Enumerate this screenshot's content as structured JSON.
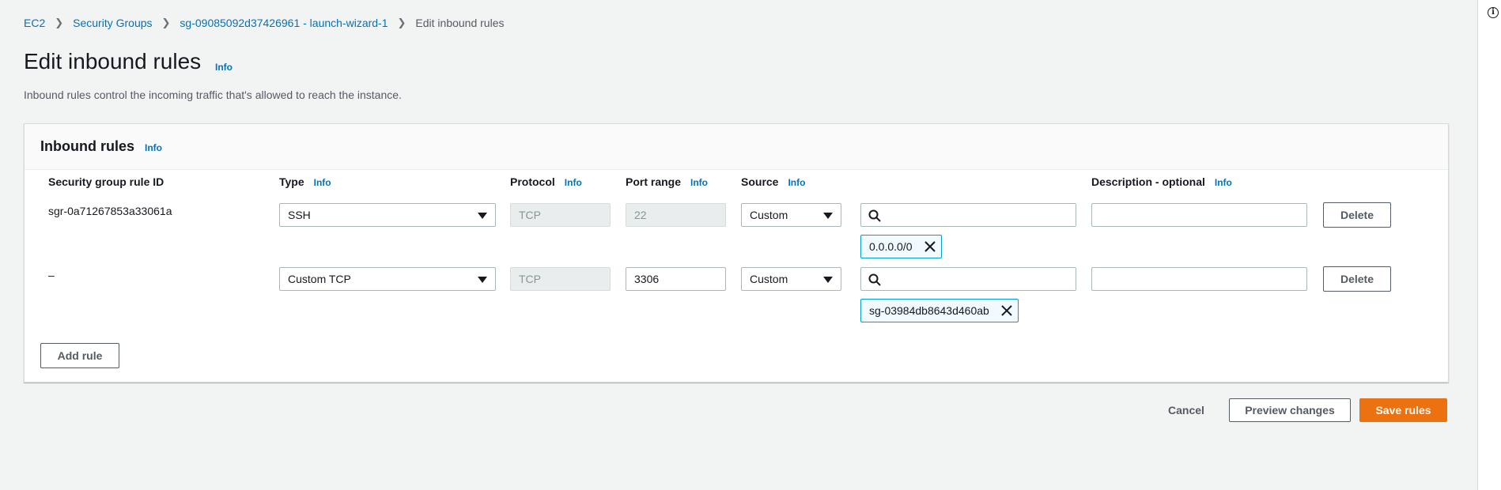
{
  "breadcrumb": {
    "items": [
      "EC2",
      "Security Groups",
      "sg-09085092d37426961 - launch-wizard-1"
    ],
    "current": "Edit inbound rules",
    "separator": ">"
  },
  "page": {
    "title": "Edit inbound rules",
    "info": "Info",
    "description": "Inbound rules control the incoming traffic that's allowed to reach the instance."
  },
  "panel": {
    "title": "Inbound rules",
    "info": "Info",
    "columns": {
      "rule_id": "Security group rule ID",
      "type": "Type",
      "protocol": "Protocol",
      "port_range": "Port range",
      "source": "Source",
      "description": "Description - optional",
      "info": "Info"
    },
    "rules": [
      {
        "rule_id": "sgr-0a71267853a33061a",
        "type": "SSH",
        "protocol": "TCP",
        "port_range": "22",
        "source": "Custom",
        "token": "0.0.0.0/0",
        "description": "",
        "delete": "Delete"
      },
      {
        "rule_id": "–",
        "type": "Custom TCP",
        "protocol": "TCP",
        "port_range": "3306",
        "source": "Custom",
        "token": "sg-03984db8643d460ab",
        "description": "",
        "delete": "Delete"
      }
    ],
    "add_rule": "Add rule"
  },
  "footer": {
    "cancel": "Cancel",
    "preview": "Preview changes",
    "save": "Save rules"
  },
  "colors": {
    "link": "#0073bb",
    "primary_button": "#ec7211",
    "token_border": "#00a1c9",
    "background": "#f2f3f3"
  }
}
